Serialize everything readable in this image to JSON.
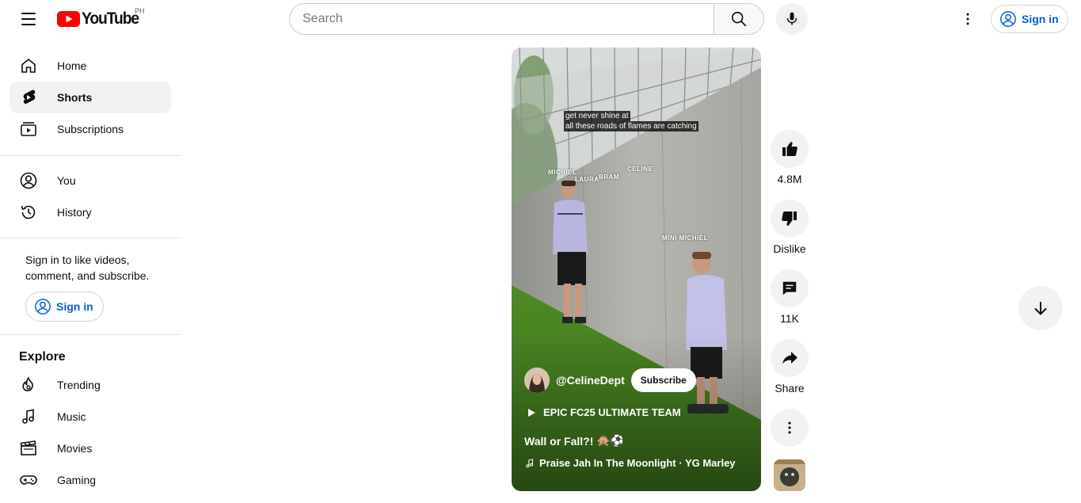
{
  "header": {
    "menu_icon": "hamburger-menu-icon",
    "logo_text": "YouTube",
    "country_code": "PH",
    "search_placeholder": "Search",
    "search_icon": "search-icon",
    "mic_icon": "microphone-icon",
    "more_icon": "vertical-dots-icon",
    "signin_label": "Sign in"
  },
  "sidebar": {
    "main": [
      {
        "label": "Home",
        "icon": "home-icon"
      },
      {
        "label": "Shorts",
        "icon": "shorts-icon",
        "active": true
      },
      {
        "label": "Subscriptions",
        "icon": "subscriptions-icon"
      }
    ],
    "you": [
      {
        "label": "You",
        "icon": "account-circle-icon"
      },
      {
        "label": "History",
        "icon": "history-icon"
      }
    ],
    "signin_prompt": "Sign in to like videos, comment, and subscribe.",
    "signin_label": "Sign in",
    "explore_title": "Explore",
    "explore": [
      {
        "label": "Trending",
        "icon": "trending-flame-icon"
      },
      {
        "label": "Music",
        "icon": "music-note-icon"
      },
      {
        "label": "Movies",
        "icon": "clapperboard-icon"
      },
      {
        "label": "Gaming",
        "icon": "gamepad-icon"
      }
    ]
  },
  "short": {
    "caption_line1": "get never shine at",
    "caption_line2": "all these roads of flames are catching",
    "tags": [
      "MICHIEL",
      "LAURA",
      "BRAM",
      "CELINE",
      "MINI MICHIEL"
    ],
    "channel_handle": "@CelineDept",
    "subscribe_label": "Subscribe",
    "playlist_title": "EPIC FC25 ULTIMATE TEAM",
    "video_title": "Wall or Fall?!",
    "title_emojis": "🙊⚽",
    "sound_title": "Praise Jah In The Moonlight · YG Marley"
  },
  "actions": {
    "like_count": "4.8M",
    "dislike_label": "Dislike",
    "comment_count": "11K",
    "share_label": "Share"
  },
  "colors": {
    "brand_red": "#ff0000",
    "link_blue": "#065fd4",
    "chip_gray": "#f2f2f2"
  }
}
